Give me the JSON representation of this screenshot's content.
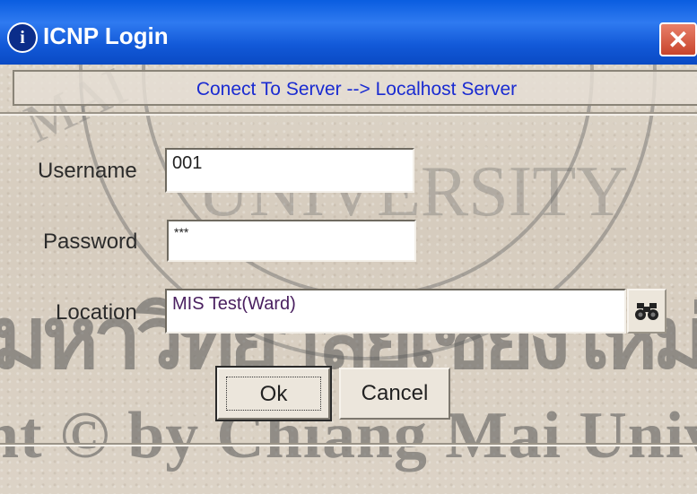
{
  "window": {
    "title": "ICNP Login"
  },
  "server": {
    "status_text": "Conect To Server --> Localhost Server"
  },
  "form": {
    "username_label": "Username",
    "username_value": "001",
    "password_label": "Password",
    "password_value": "***",
    "location_label": "Location",
    "location_value": "MIS Test(Ward)"
  },
  "buttons": {
    "ok_label": "Ok",
    "cancel_label": "Cancel"
  },
  "colors": {
    "titlebar": "#1259d8",
    "server_text": "#1a2bd1",
    "location_text": "#4a2060"
  },
  "icons": [
    "info-icon",
    "close-icon",
    "binoculars-icon"
  ]
}
